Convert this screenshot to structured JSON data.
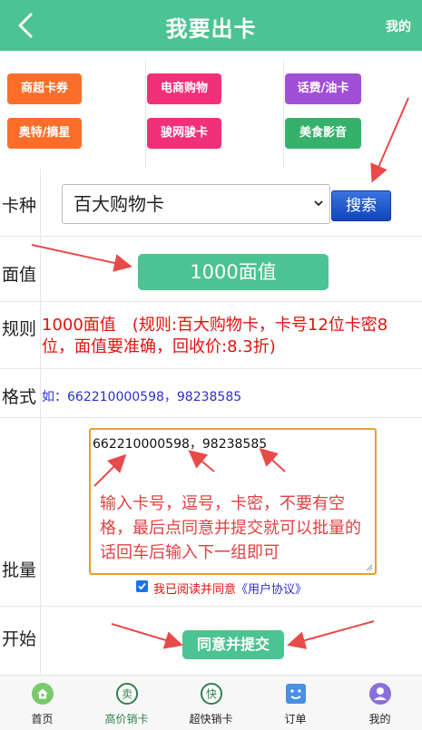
{
  "header": {
    "title": "我要出卡",
    "mine_label": "我的"
  },
  "categories": [
    {
      "label": "商超卡券",
      "color": "#fa6e2a"
    },
    {
      "label": "电商购物",
      "color": "#f2307a"
    },
    {
      "label": "话费/油卡",
      "color": "#a14fd6"
    },
    {
      "label": "奥特/摘星",
      "color": "#fa6e2a"
    },
    {
      "label": "骏网骏卡",
      "color": "#f2307a"
    },
    {
      "label": "美食影音",
      "color": "#36b16b"
    }
  ],
  "form": {
    "card_type_label": "卡种",
    "card_type_value": "百大购物卡",
    "search_label": "搜索",
    "face_label": "面值",
    "face_value": "1000面值",
    "rule_label": "规则",
    "rule_text": "1000面值　(规则:百大购物卡，卡号12位卡密8位，面值要准确，回收价:8.3折)",
    "format_label": "格式",
    "format_text": "如：662210000598，98238585",
    "batch_label": "批量",
    "batch_value": "662210000598，98238585",
    "batch_hint": "输入卡号，逗号，卡密，不要有空格，最后点同意并提交就可以批量的话回车后输入下一组即可",
    "agree_text": "我已阅读并同意",
    "agree_link": "《用户协议》",
    "start_label": "开始",
    "submit_label": "同意并提交"
  },
  "tabs": [
    {
      "label": "首页",
      "icon": "home-icon"
    },
    {
      "label": "高价销卡",
      "icon": "sell-icon"
    },
    {
      "label": "超快销卡",
      "icon": "fast-icon"
    },
    {
      "label": "订单",
      "icon": "order-icon"
    },
    {
      "label": "我的",
      "icon": "user-icon"
    }
  ],
  "colors": {
    "brand": "#4bc393",
    "rule_red": "#e3110e",
    "link_blue": "#2b2fd1",
    "search_blue": "#1e57c8"
  }
}
